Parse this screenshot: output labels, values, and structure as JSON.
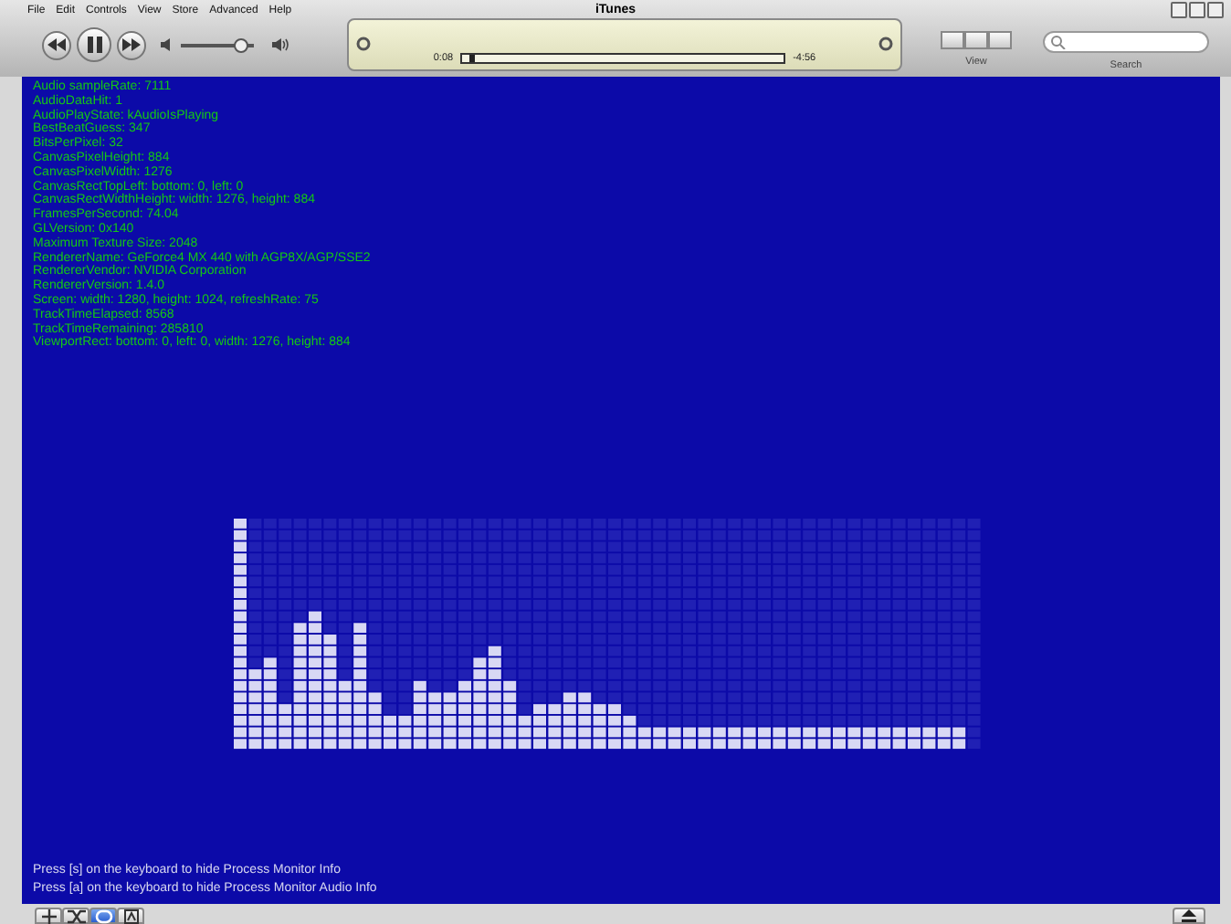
{
  "window": {
    "title": "iTunes"
  },
  "menu": [
    "File",
    "Edit",
    "Controls",
    "View",
    "Store",
    "Advanced",
    "Help"
  ],
  "player": {
    "volume": {
      "level": 0.82
    },
    "elapsed": "0:08",
    "remaining": "-4:56",
    "progress": {
      "level": 0.02
    }
  },
  "view": {
    "label": "View"
  },
  "search": {
    "label": "Search"
  },
  "info_lines": [
    "Audio sampleRate: 7111",
    "AudioDataHit: 1",
    "AudioPlayState: kAudioIsPlaying",
    "BestBeatGuess: 347",
    "BitsPerPixel: 32",
    "CanvasPixelHeight: 884",
    "CanvasPixelWidth: 1276",
    "CanvasRectTopLeft: bottom: 0, left: 0",
    "CanvasRectWidthHeight: width: 1276, height: 884",
    "FramesPerSecond: 74.04",
    "GLVersion: 0x140",
    "Maximum Texture Size: 2048",
    "RendererName: GeForce4 MX 440 with AGP8X/AGP/SSE2",
    "RendererVendor: NVIDIA Corporation",
    "RendererVersion: 1.4.0",
    "Screen: width: 1280, height: 1024, refreshRate: 75",
    "TrackTimeElapsed: 8568",
    "TrackTimeRemaining: 285810",
    "ViewportRect: bottom: 0, left: 0, width: 1276, height: 884"
  ],
  "footer_lines": [
    "Press [s] on the keyboard to hide Process Monitor Info",
    "Press [a] on the keyboard to hide Process Monitor Audio Info"
  ],
  "bottom_bar": {
    "shuffle": {
      "on": false
    },
    "repeat": {
      "on": true
    }
  }
}
